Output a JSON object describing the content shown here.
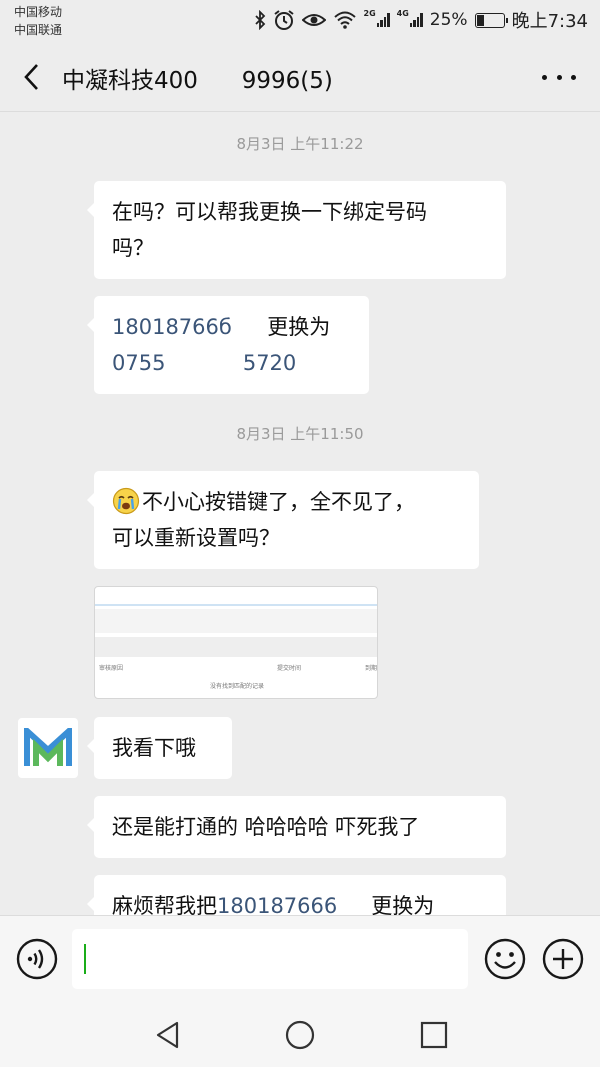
{
  "status_bar": {
    "carrier_1": "中国移动",
    "carrier_2": "中国联通",
    "network_1": "2G",
    "network_2": "4G",
    "battery_percent": "25%",
    "battery_level": 0.25,
    "time": "晚上7:34",
    "icons": [
      "bluetooth-icon",
      "alarm-icon",
      "eye-protection-icon",
      "wifi-icon",
      "signal-icon",
      "battery-icon"
    ]
  },
  "header": {
    "title": "中凝科技400      9996(5)"
  },
  "messages": {
    "timestamp_1": "8月3日 上午11:22",
    "msg_1": "在吗？可以帮我更换一下绑定号码\n吗？",
    "msg_2": {
      "number_from": "18018766б",
      "action": "更换为",
      "number_to_a": "0755",
      "number_to_b": "5720"
    },
    "timestamp_2": "8月3日 上午11:50",
    "msg_3_emoji": "crying-face-emoji",
    "msg_3": "不小心按错键了，全不见了，\n可以重新设置吗？",
    "image_labels": {
      "col_1": "审核原因",
      "col_2": "提交时间",
      "col_3": "到期",
      "empty": "没有找到匹配的记录"
    },
    "msg_4": "我看下哦",
    "msg_5": "还是能打通的 哈哈哈哈 吓死我了",
    "msg_6": {
      "prefix": "麻烦帮我把",
      "number": "180187666",
      "suffix": "更换为"
    }
  },
  "colors": {
    "background": "#ededed",
    "bubble": "#ffffff",
    "phone_link": "#3b5578",
    "cursor": "#1aad19",
    "avatar_green": "#5cb85c",
    "avatar_blue": "#3a8fd6"
  }
}
